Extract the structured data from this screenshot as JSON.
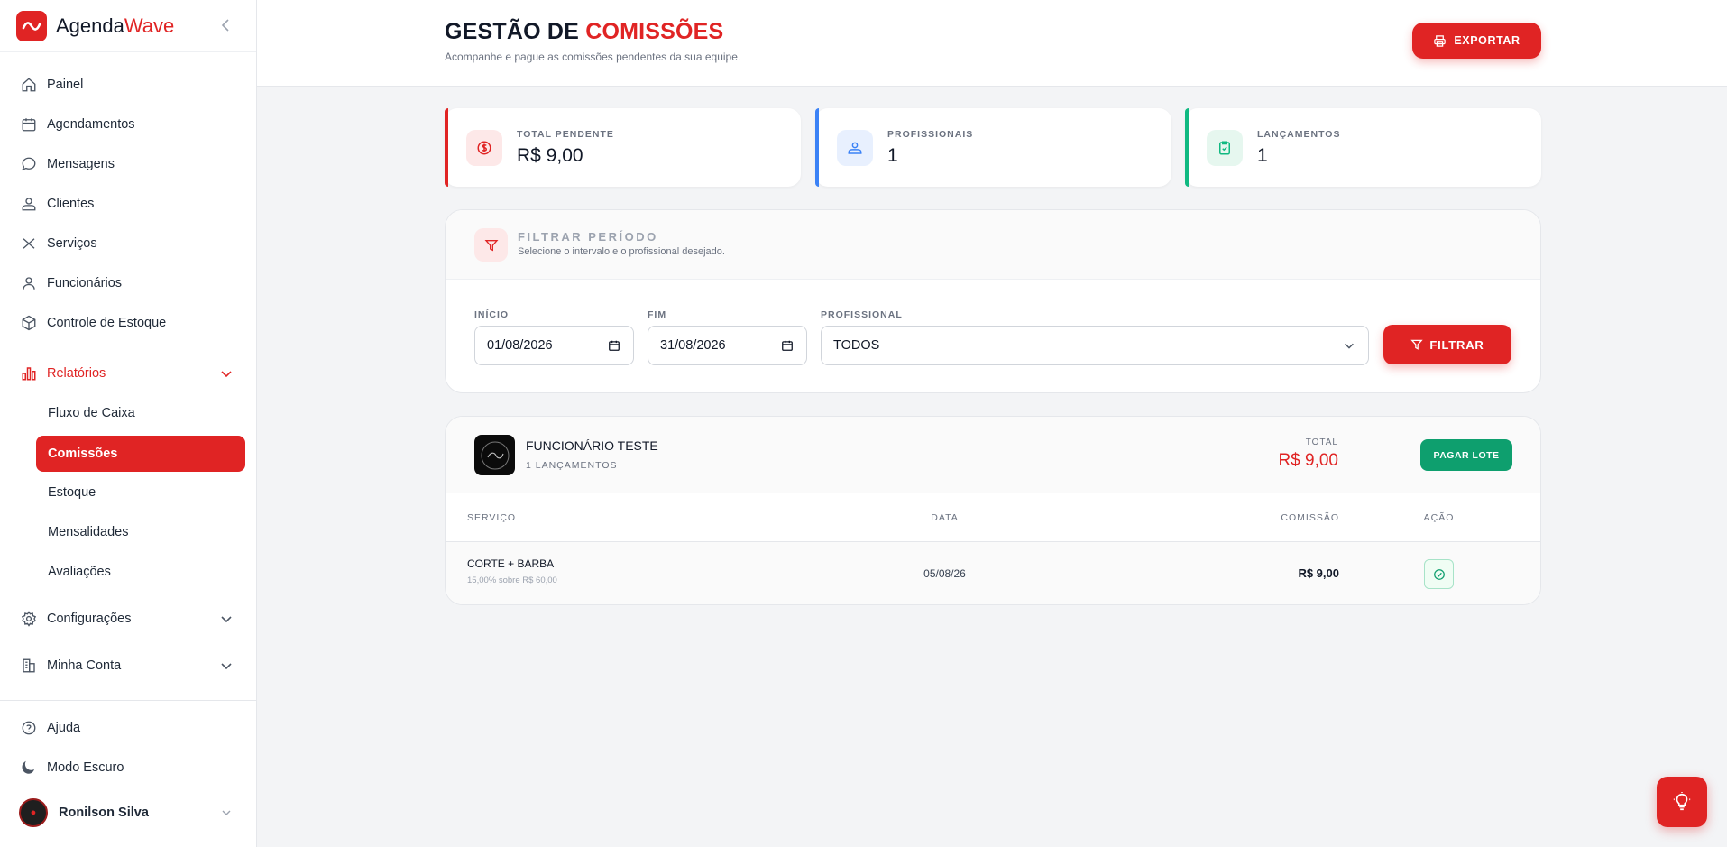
{
  "app": {
    "name_part1": "Agenda",
    "name_part2": "Wave"
  },
  "sidebar": {
    "items": [
      {
        "label": "Painel",
        "icon": "home-icon"
      },
      {
        "label": "Agendamentos",
        "icon": "calendar-icon"
      },
      {
        "label": "Mensagens",
        "icon": "chat-icon"
      },
      {
        "label": "Clientes",
        "icon": "users-icon"
      },
      {
        "label": "Serviços",
        "icon": "scissors-icon"
      },
      {
        "label": "Funcionários",
        "icon": "user-icon"
      },
      {
        "label": "Controle de Estoque",
        "icon": "box-icon"
      }
    ],
    "reports": {
      "label": "Relatórios",
      "icon": "chart-bar-icon",
      "expanded": true,
      "sub_items": [
        "Fluxo de Caixa",
        "Comissões",
        "Estoque",
        "Mensalidades",
        "Avaliações"
      ],
      "active": "Comissões"
    },
    "settings_label": "Configurações",
    "account_label": "Minha Conta",
    "help_label": "Ajuda",
    "dark_mode_label": "Modo Escuro",
    "user_name": "Ronilson Silva"
  },
  "header": {
    "title_part1": "GESTÃO DE",
    "title_part2": "COMISSÕES",
    "subtitle": "Acompanhe e pague as comissões pendentes da sua equipe.",
    "export_label": "EXPORTAR"
  },
  "stats": [
    {
      "label": "TOTAL PENDENTE",
      "value": "R$ 9,00",
      "color": "#e02424",
      "icon": "dollar-circle-icon"
    },
    {
      "label": "PROFISSIONAIS",
      "value": "1",
      "color": "#3b82f6",
      "icon": "users-icon"
    },
    {
      "label": "LANÇAMENTOS",
      "value": "1",
      "color": "#10b981",
      "icon": "clipboard-check-icon"
    }
  ],
  "filter": {
    "title": "FILTRAR PERÍODO",
    "subtitle": "Selecione o intervalo e o profissional desejado.",
    "start_label": "INÍCIO",
    "start_value": "01/08/2026",
    "end_label": "FIM",
    "end_value": "31/08/2026",
    "professional_label": "PROFISSIONAL",
    "professional_value": "TODOS",
    "button_label": "FILTRAR"
  },
  "employee": {
    "name": "FUNCIONÁRIO TESTE",
    "count_text": "1 LANÇAMENTOS",
    "total_label": "TOTAL",
    "total_value": "R$ 9,00",
    "pay_label": "PAGAR LOTE",
    "columns": {
      "service": "SERVIÇO",
      "date": "DATA",
      "commission": "COMISSÃO",
      "action": "AÇÃO"
    },
    "rows": [
      {
        "service": "CORTE + BARBA",
        "detail": "15,00% sobre R$ 60,00",
        "date": "05/08/26",
        "commission": "R$ 9,00"
      }
    ]
  },
  "colors": {
    "accent": "#e02424",
    "success": "#0e9f6e",
    "info": "#3b82f6"
  }
}
